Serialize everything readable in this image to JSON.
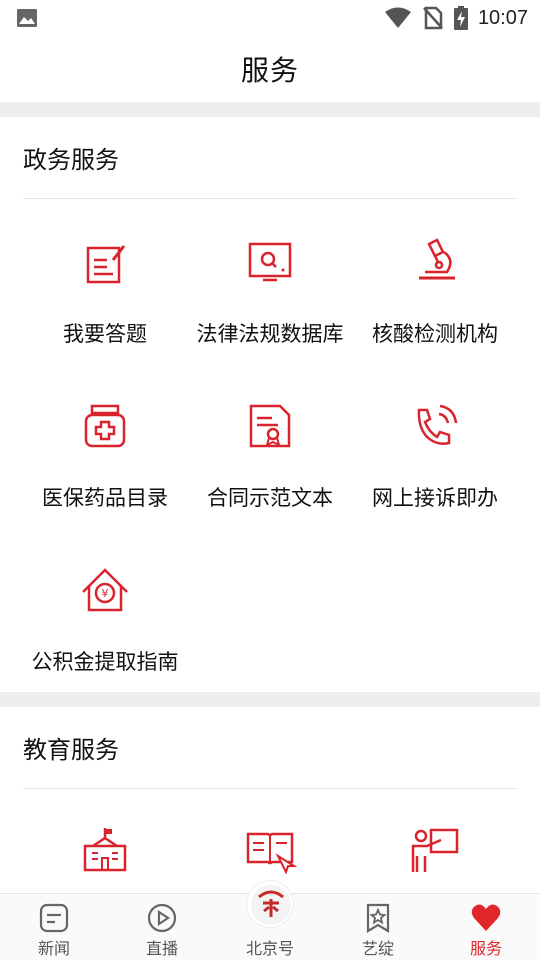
{
  "status_bar": {
    "time": "10:07"
  },
  "header": {
    "title": "服务"
  },
  "sections": [
    {
      "title": "政务服务",
      "items": [
        {
          "label": "我要答题",
          "icon": "edit-note-icon"
        },
        {
          "label": "法律法规数据库",
          "icon": "monitor-search-icon"
        },
        {
          "label": "核酸检测机构",
          "icon": "microscope-icon"
        },
        {
          "label": "医保药品目录",
          "icon": "medicine-bottle-icon"
        },
        {
          "label": "合同示范文本",
          "icon": "contract-document-icon"
        },
        {
          "label": "网上接诉即办",
          "icon": "phone-call-icon"
        },
        {
          "label": "公积金提取指南",
          "icon": "house-fund-icon"
        }
      ]
    },
    {
      "title": "教育服务",
      "items": [
        {
          "label": "",
          "icon": "school-building-icon"
        },
        {
          "label": "",
          "icon": "reading-book-icon"
        },
        {
          "label": "",
          "icon": "teacher-board-icon"
        }
      ]
    }
  ],
  "bottom_nav": [
    {
      "label": "新闻",
      "icon": "news-icon",
      "active": false
    },
    {
      "label": "直播",
      "icon": "play-icon",
      "active": false
    },
    {
      "label": "北京号",
      "icon": "beijing-logo-icon",
      "active": false
    },
    {
      "label": "艺绽",
      "icon": "star-bookmark-icon",
      "active": false
    },
    {
      "label": "服务",
      "icon": "heart-icon",
      "active": true
    }
  ],
  "colors": {
    "accent": "#e0262b",
    "icon_red": "#d9232d",
    "gap": "#eeeeee"
  }
}
